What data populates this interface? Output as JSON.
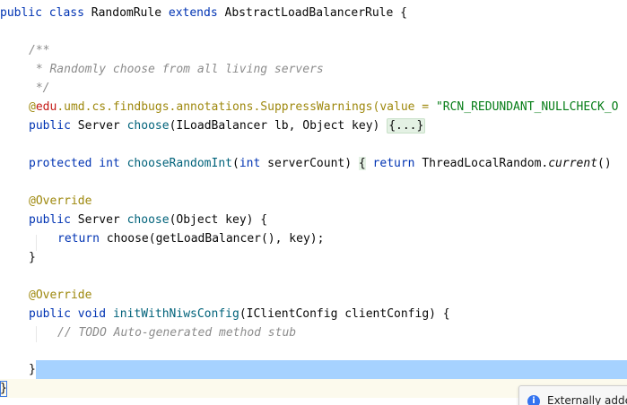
{
  "editor": {
    "lines": {
      "class_decl": {
        "kw1": "public",
        "kw2": "class",
        "name": "RandomRule",
        "kw3": "extends",
        "super": "AbstractLoadBalancerRule",
        "brace": "{"
      },
      "doc_open": "/**",
      "doc_body": " * Randomly choose from all living servers",
      "doc_close": " */",
      "annotation": {
        "at": "@",
        "pkg_edu": "edu",
        "rest": ".umd.cs.findbugs.annotations.SuppressWarnings(value = ",
        "value": "\"RCN_REDUNDANT_NULLCHECK_O"
      },
      "choose_lb": {
        "kw": "public",
        "type": " Server ",
        "fn": "choose",
        "params": "(ILoadBalancer lb, Object key) ",
        "fold": "{...}"
      },
      "random_int": {
        "kw1": "protected",
        "kw2": " int ",
        "fn": "chooseRandomInt",
        "p_open": "(",
        "kw3": "int",
        "params": " serverCount) ",
        "brace": "{",
        "sp": " ",
        "kw4": "return",
        "rest": " ThreadLocalRandom.",
        "call": "current",
        "tail": "()"
      },
      "override_1": "@Override",
      "choose_key": {
        "kw": "public",
        "type": " Server ",
        "fn": "choose",
        "params": "(Object key) {"
      },
      "return_line": {
        "kw": "return",
        "rest": " choose(getLoadBalancer(), key);"
      },
      "close_1": "}",
      "override_2": "@Override",
      "init_config": {
        "kw1": "public",
        "kw2": " void ",
        "fn": "initWithNiwsConfig",
        "params": "(IClientConfig clientConfig) {"
      },
      "todo": "// TODO Auto-generated method stub",
      "close_2": "}",
      "close_class": "}"
    }
  },
  "notification": {
    "icon": "info-icon",
    "text": "Externally adde"
  },
  "colors": {
    "keyword": "#0033b3",
    "method": "#00627a",
    "annotation": "#9e880d",
    "string": "#067d17",
    "comment": "#8c8c8c",
    "selection": "#a6d2ff"
  }
}
